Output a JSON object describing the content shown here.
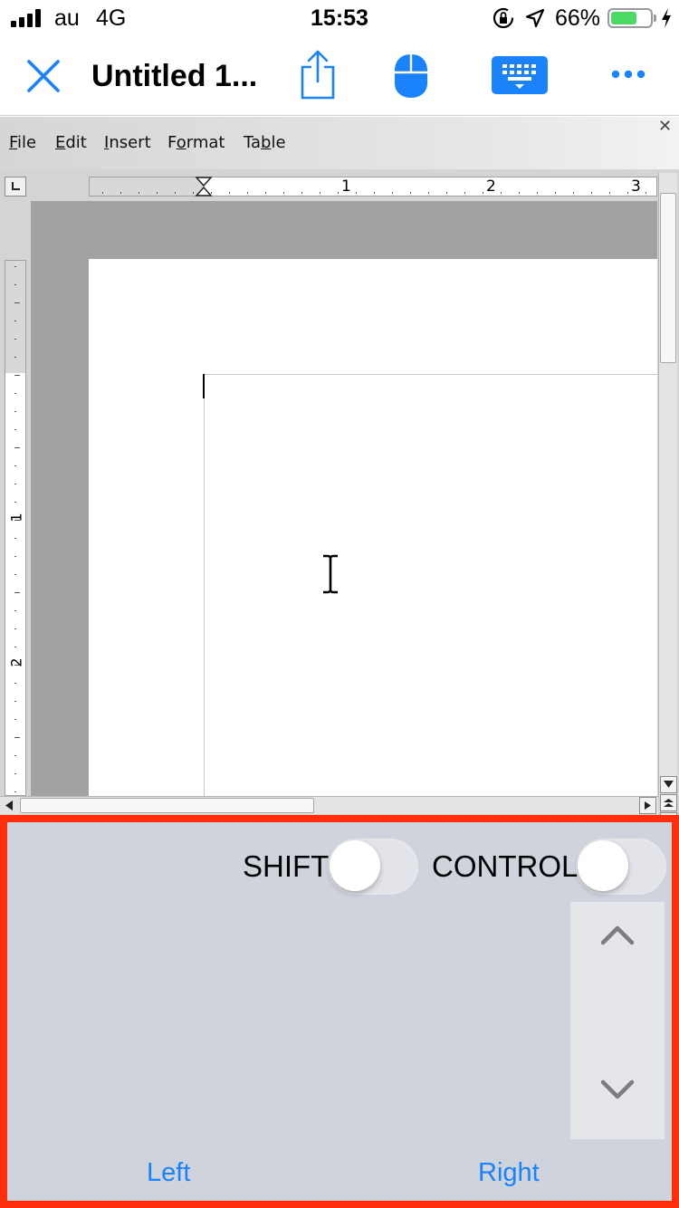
{
  "status_bar": {
    "carrier": "au",
    "network": "4G",
    "time": "15:53",
    "battery_percent": "66%",
    "battery_level": 0.66,
    "icons": [
      "signal-icon",
      "rotation-lock-icon",
      "location-arrow-icon",
      "battery-icon",
      "charging-bolt-icon"
    ]
  },
  "header": {
    "title": "Untitled 1...",
    "accent_color": "#1a82fb",
    "icons": [
      "close-icon",
      "share-icon",
      "mouse-icon",
      "keyboard-icon",
      "more-icon"
    ]
  },
  "remote": {
    "menu": [
      "File",
      "Edit",
      "Insert",
      "Format",
      "Table"
    ],
    "menu_accelerators": [
      "F",
      "E",
      "I",
      "o",
      "b"
    ],
    "ruler_h_labels": [
      "1",
      "2",
      "3"
    ],
    "ruler_v_labels": [
      "1",
      "2"
    ]
  },
  "pad": {
    "shift_label": "SHIFT",
    "control_label": "CONTROL",
    "shift_on": false,
    "control_on": false,
    "left_label": "Left",
    "right_label": "Right",
    "border_color": "#fe2d0b"
  }
}
